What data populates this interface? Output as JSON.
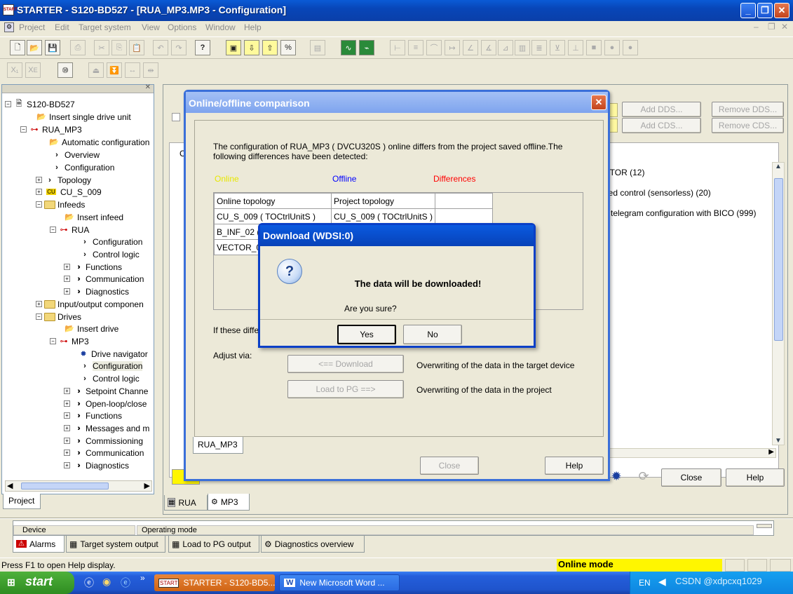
{
  "window": {
    "title": "STARTER - S120-BD527 - [RUA_MP3.MP3 - Configuration]",
    "app_icon": "START"
  },
  "menu": [
    "Project",
    "Edit",
    "Target system",
    "View",
    "Options",
    "Window",
    "Help"
  ],
  "tree": {
    "items": [
      {
        "label": "S120-BD527"
      },
      {
        "label": "Insert single drive unit"
      },
      {
        "label": "RUA_MP3"
      },
      {
        "label": "Automatic configuration"
      },
      {
        "label": "Overview"
      },
      {
        "label": "Configuration"
      },
      {
        "label": "Topology"
      },
      {
        "label": "CU_S_009",
        "badge": "CU"
      },
      {
        "label": "Infeeds"
      },
      {
        "label": "Insert infeed"
      },
      {
        "label": "RUA"
      },
      {
        "label": "Configuration"
      },
      {
        "label": "Control logic"
      },
      {
        "label": "Functions"
      },
      {
        "label": "Communication"
      },
      {
        "label": "Diagnostics"
      },
      {
        "label": "Input/output componen"
      },
      {
        "label": "Drives"
      },
      {
        "label": "Insert drive"
      },
      {
        "label": "MP3"
      },
      {
        "label": "Drive navigator"
      },
      {
        "label": "Configuration"
      },
      {
        "label": "Control logic"
      },
      {
        "label": "Setpoint Channe"
      },
      {
        "label": "Open-loop/close"
      },
      {
        "label": "Functions"
      },
      {
        "label": "Messages and m"
      },
      {
        "label": "Commissioning"
      },
      {
        "label": "Communication"
      },
      {
        "label": "Diagnostics"
      }
    ],
    "tab": "Project"
  },
  "workspace": {
    "add_dds": "Add DDS...",
    "remove_dds": "Remove DDS...",
    "add_cds": "Add CDS...",
    "remove_cds": "Remove CDS...",
    "lines": [
      "CTOR (12)",
      "eed control (sensorless) (20)",
      "e telegram configuration with BICO (999)"
    ],
    "close": "Close",
    "help": "Help",
    "tabs": [
      "RUA",
      "MP3"
    ]
  },
  "comparison": {
    "title": "Online/offline comparison",
    "message": "The configuration of RUA_MP3 ( DVCU320S ) online differs   from the project saved offline.The following differences have been detected:",
    "legend": {
      "online": "Online",
      "offline": "Offline",
      "differences": "Differences"
    },
    "colors": {
      "online": "#e8e800",
      "offline": "#0000ff",
      "differences": "#ff0000"
    },
    "rows": [
      [
        "Online topology",
        "Project topology"
      ],
      [
        "CU_S_009 ( TOCtrlUnitS )",
        "CU_S_009 ( TOCtrlUnitS )"
      ],
      [
        "B_INF_02 (",
        ""
      ],
      [
        "VECTOR_0",
        ""
      ]
    ],
    "if_these": "If these differ",
    "adjust_via": "Adjust via:",
    "download_btn": "<== Download",
    "download_desc": "Overwriting of the data in the target device",
    "load_btn": "Load to PG ==>",
    "load_desc": "Overwriting of the data in the project",
    "tab": "RUA_MP3",
    "close": "Close",
    "help": "Help"
  },
  "download_dialog": {
    "title": "Download (WDSI:0)",
    "heading": "The data will be downloaded!",
    "question": "Are you sure?",
    "yes": "Yes",
    "no": "No"
  },
  "bottom": {
    "col1": "Device",
    "col2": "Operating mode",
    "tabs": [
      "Alarms",
      "Target system output",
      "Load to PG output",
      "Diagnostics overview"
    ]
  },
  "status": {
    "help": "Press F1 to open Help display.",
    "mode": "Online mode"
  },
  "taskbar": {
    "start": "start",
    "tasks": [
      "STARTER - S120-BD5...",
      "New Microsoft Word ..."
    ],
    "lang": "EN",
    "watermark": "CSDN @xdpcxq1029"
  }
}
